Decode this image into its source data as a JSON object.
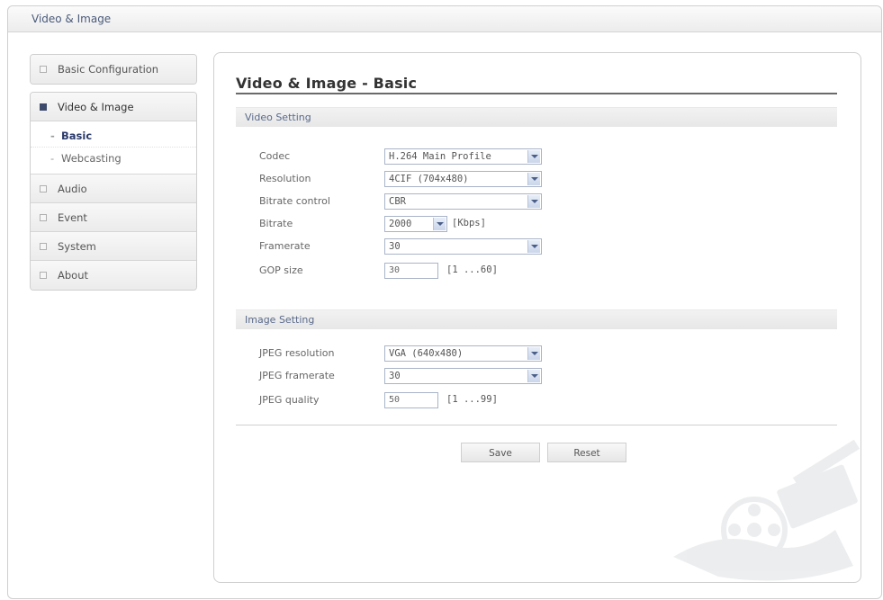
{
  "window": {
    "title": "Video & Image"
  },
  "sidebar": {
    "basic_configuration": "Basic Configuration",
    "video_image": {
      "label": "Video & Image",
      "sub_items": [
        "Basic",
        "Webcasting"
      ]
    },
    "items": [
      "Audio",
      "Event",
      "System",
      "About"
    ]
  },
  "page": {
    "title": "Video & Image - Basic"
  },
  "video_setting": {
    "heading": "Video Setting",
    "codec": {
      "label": "Codec",
      "value": "H.264 Main Profile"
    },
    "resolution": {
      "label": "Resolution",
      "value": "4CIF (704x480)"
    },
    "bitrate_control": {
      "label": "Bitrate control",
      "value": "CBR"
    },
    "bitrate": {
      "label": "Bitrate",
      "value": "2000",
      "unit": "[Kbps]"
    },
    "framerate": {
      "label": "Framerate",
      "value": "30"
    },
    "gop_size": {
      "label": "GOP size",
      "value": "30",
      "range": "[1 ...60]"
    }
  },
  "image_setting": {
    "heading": "Image Setting",
    "jpeg_resolution": {
      "label": "JPEG resolution",
      "value": "VGA (640x480)"
    },
    "jpeg_framerate": {
      "label": "JPEG framerate",
      "value": "30"
    },
    "jpeg_quality": {
      "label": "JPEG quality",
      "value": "50",
      "range": "[1 ...99]"
    }
  },
  "buttons": {
    "save": "Save",
    "reset": "Reset"
  },
  "colors": {
    "accent": "#3d4a6b",
    "select_border": "#a9b4c8",
    "title_text": "#333333"
  }
}
